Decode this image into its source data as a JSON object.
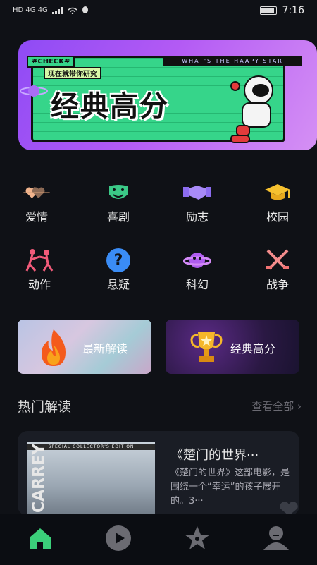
{
  "status_bar": {
    "left_text": "HD 4G 4G",
    "time": "7:16"
  },
  "banner": {
    "tag": "#CHECK#",
    "subtitle": "现在就带你研究",
    "top_text": "WHAT'S THE HAAPY STAR",
    "title": "经典高分"
  },
  "categories": [
    {
      "label": "爱情",
      "icon": "heart-icon"
    },
    {
      "label": "喜剧",
      "icon": "comedy-mask-icon"
    },
    {
      "label": "励志",
      "icon": "handshake-icon"
    },
    {
      "label": "校园",
      "icon": "graduation-cap-icon"
    },
    {
      "label": "动作",
      "icon": "fighter-icon"
    },
    {
      "label": "悬疑",
      "icon": "question-icon"
    },
    {
      "label": "科幻",
      "icon": "planet-icon"
    },
    {
      "label": "战争",
      "icon": "crossed-swords-icon"
    }
  ],
  "features": [
    {
      "label": "最新解读",
      "icon": "flame-icon"
    },
    {
      "label": "经典高分",
      "icon": "trophy-icon"
    }
  ],
  "hot_section": {
    "title": "热门解读",
    "view_all": "查看全部"
  },
  "card": {
    "title": "《楚门的世界···",
    "desc": "《楚门的世界》这部电影，是围绕一个“幸运”的孩子展开的。3···",
    "poster_edition": "SPECIAL COLLECTOR'S EDITION",
    "poster_name": "CARREY"
  },
  "tabs": [
    {
      "name": "home",
      "icon": "home-icon",
      "active": true
    },
    {
      "name": "play",
      "icon": "play-icon",
      "active": false
    },
    {
      "name": "favorites",
      "icon": "star-icon",
      "active": false
    },
    {
      "name": "profile",
      "icon": "user-icon",
      "active": false
    }
  ],
  "colors": {
    "accent": "#3bd07a",
    "bg": "#0f1116",
    "tab_inactive": "#6b6b72"
  }
}
